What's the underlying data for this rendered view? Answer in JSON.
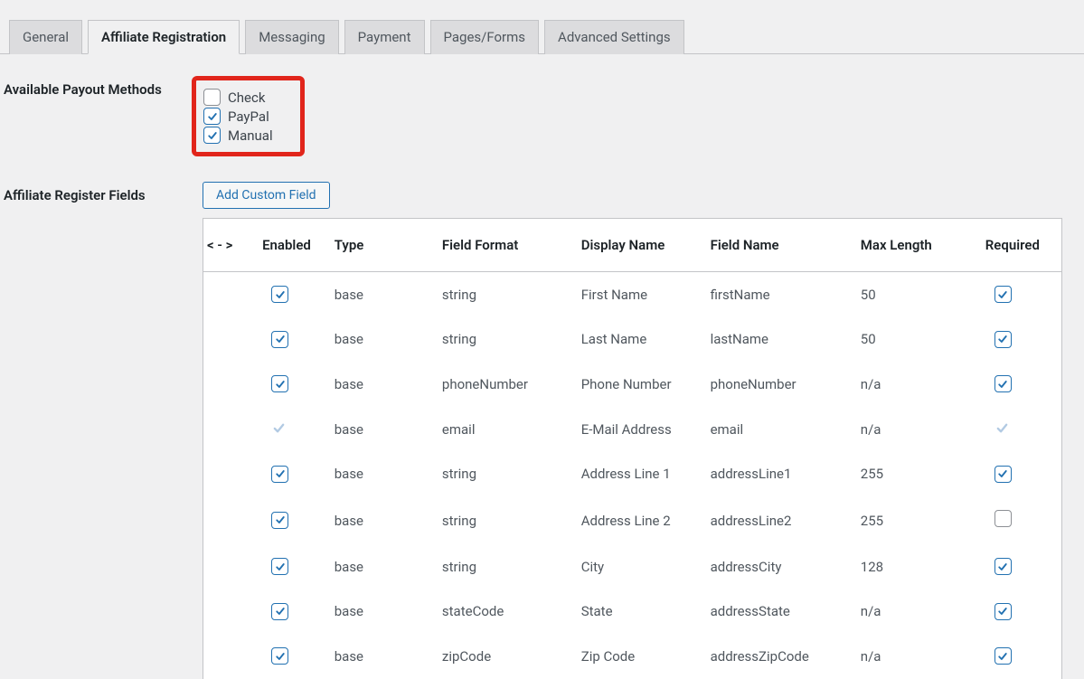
{
  "tabs": [
    {
      "label": "General",
      "active": false
    },
    {
      "label": "Affiliate Registration",
      "active": true
    },
    {
      "label": "Messaging",
      "active": false
    },
    {
      "label": "Payment",
      "active": false
    },
    {
      "label": "Pages/Forms",
      "active": false
    },
    {
      "label": "Advanced Settings",
      "active": false
    }
  ],
  "payout": {
    "label": "Available Payout Methods",
    "methods": [
      {
        "label": "Check",
        "checked": false
      },
      {
        "label": "PayPal",
        "checked": true
      },
      {
        "label": "Manual",
        "checked": true
      }
    ]
  },
  "registerFields": {
    "label": "Affiliate Register Fields",
    "addButton": "Add Custom Field",
    "headers": {
      "drag": "< - >",
      "enabled": "Enabled",
      "type": "Type",
      "format": "Field Format",
      "display": "Display Name",
      "field": "Field Name",
      "max": "Max Length",
      "required": "Required"
    },
    "rows": [
      {
        "enabled": true,
        "enabledLocked": false,
        "type": "base",
        "format": "string",
        "display": "First Name",
        "field": "firstName",
        "max": "50",
        "required": true,
        "requiredLocked": false
      },
      {
        "enabled": true,
        "enabledLocked": false,
        "type": "base",
        "format": "string",
        "display": "Last Name",
        "field": "lastName",
        "max": "50",
        "required": true,
        "requiredLocked": false
      },
      {
        "enabled": true,
        "enabledLocked": false,
        "type": "base",
        "format": "phoneNumber",
        "display": "Phone Number",
        "field": "phoneNumber",
        "max": "n/a",
        "required": true,
        "requiredLocked": false
      },
      {
        "enabled": true,
        "enabledLocked": true,
        "type": "base",
        "format": "email",
        "display": "E-Mail Address",
        "field": "email",
        "max": "n/a",
        "required": true,
        "requiredLocked": true
      },
      {
        "enabled": true,
        "enabledLocked": false,
        "type": "base",
        "format": "string",
        "display": "Address Line 1",
        "field": "addressLine1",
        "max": "255",
        "required": true,
        "requiredLocked": false
      },
      {
        "enabled": true,
        "enabledLocked": false,
        "type": "base",
        "format": "string",
        "display": "Address Line 2",
        "field": "addressLine2",
        "max": "255",
        "required": false,
        "requiredLocked": false
      },
      {
        "enabled": true,
        "enabledLocked": false,
        "type": "base",
        "format": "string",
        "display": "City",
        "field": "addressCity",
        "max": "128",
        "required": true,
        "requiredLocked": false
      },
      {
        "enabled": true,
        "enabledLocked": false,
        "type": "base",
        "format": "stateCode",
        "display": "State",
        "field": "addressState",
        "max": "n/a",
        "required": true,
        "requiredLocked": false
      },
      {
        "enabled": true,
        "enabledLocked": false,
        "type": "base",
        "format": "zipCode",
        "display": "Zip Code",
        "field": "addressZipCode",
        "max": "n/a",
        "required": true,
        "requiredLocked": false
      }
    ]
  }
}
